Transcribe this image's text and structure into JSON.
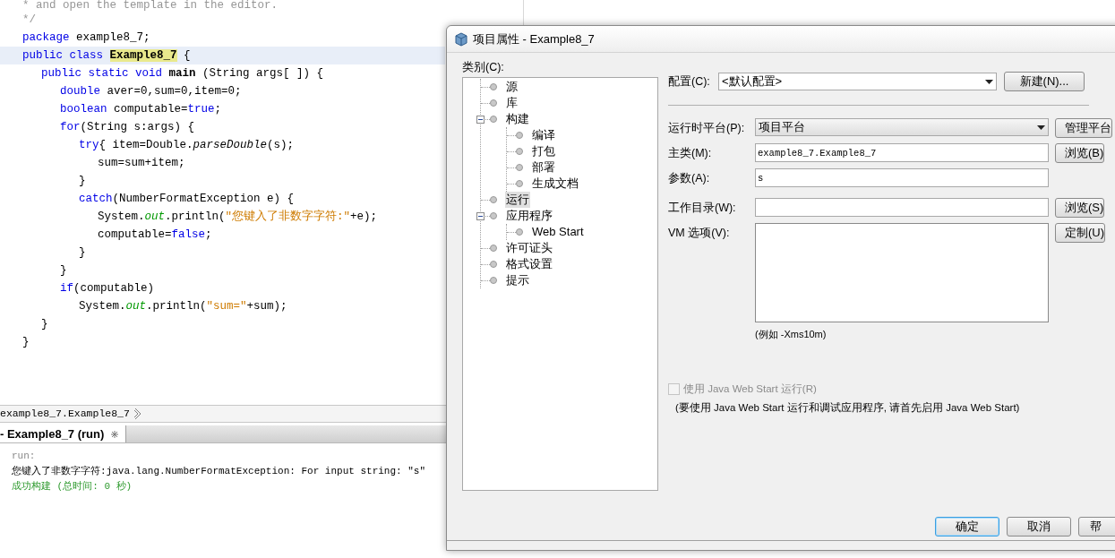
{
  "editor": {
    "lines": [
      {
        "current": false,
        "tokens": [
          {
            "kind": "comment",
            "text": "* and open the template in the editor."
          }
        ]
      },
      {
        "current": false,
        "tokens": [
          {
            "kind": "comment",
            "text": "*/"
          }
        ]
      },
      {
        "current": false,
        "tokens": [
          {
            "kind": "keyword",
            "text": "package"
          },
          {
            "kind": "plain",
            "text": " example8_7;"
          }
        ]
      },
      {
        "current": true,
        "tokens": [
          {
            "kind": "keyword",
            "text": "public class "
          },
          {
            "kind": "mark",
            "text": "Example8_7"
          },
          {
            "kind": "plain",
            "text": " {"
          }
        ],
        "children": [
          {
            "current": false,
            "tokens": [
              {
                "kind": "keyword",
                "text": "public static void "
              },
              {
                "kind": "bold",
                "text": "main"
              },
              {
                "kind": "plain",
                "text": " (String args[ ]) {"
              }
            ],
            "children": [
              {
                "current": false,
                "tokens": [
                  {
                    "kind": "keyword",
                    "text": "double"
                  },
                  {
                    "kind": "plain",
                    "text": " aver=0,sum=0,item=0;"
                  }
                ]
              },
              {
                "current": false,
                "tokens": [
                  {
                    "kind": "keyword",
                    "text": "boolean"
                  },
                  {
                    "kind": "plain",
                    "text": " computable="
                  },
                  {
                    "kind": "keyword",
                    "text": "true"
                  },
                  {
                    "kind": "plain",
                    "text": ";"
                  }
                ]
              },
              {
                "current": false,
                "tokens": [
                  {
                    "kind": "keyword",
                    "text": "for"
                  },
                  {
                    "kind": "plain",
                    "text": "(String s:args) {"
                  }
                ],
                "children": [
                  {
                    "current": false,
                    "tokens": [
                      {
                        "kind": "keyword",
                        "text": "try"
                      },
                      {
                        "kind": "plain",
                        "text": "{ item=Double."
                      },
                      {
                        "kind": "italic",
                        "text": "parseDouble"
                      },
                      {
                        "kind": "plain",
                        "text": "(s);"
                      }
                    ],
                    "children": [
                      {
                        "current": false,
                        "tokens": [
                          {
                            "kind": "plain",
                            "text": "sum=sum+item;"
                          }
                        ]
                      }
                    ]
                  },
                  {
                    "current": false,
                    "tokens": [
                      {
                        "kind": "plain",
                        "text": "}"
                      }
                    ]
                  },
                  {
                    "current": false,
                    "tokens": [
                      {
                        "kind": "keyword",
                        "text": "catch"
                      },
                      {
                        "kind": "plain",
                        "text": "(NumberFormatException e) {"
                      }
                    ],
                    "children": [
                      {
                        "current": false,
                        "tokens": [
                          {
                            "kind": "plain",
                            "text": "System."
                          },
                          {
                            "kind": "field",
                            "text": "out"
                          },
                          {
                            "kind": "plain",
                            "text": ".println("
                          },
                          {
                            "kind": "string",
                            "text": "\"您键入了非数字字符:\""
                          },
                          {
                            "kind": "plain",
                            "text": "+e);"
                          }
                        ]
                      },
                      {
                        "current": false,
                        "tokens": [
                          {
                            "kind": "plain",
                            "text": "computable="
                          },
                          {
                            "kind": "keyword",
                            "text": "false"
                          },
                          {
                            "kind": "plain",
                            "text": ";"
                          }
                        ]
                      }
                    ]
                  },
                  {
                    "current": false,
                    "tokens": [
                      {
                        "kind": "plain",
                        "text": "}"
                      }
                    ]
                  }
                ]
              },
              {
                "current": false,
                "tokens": [
                  {
                    "kind": "plain",
                    "text": "}"
                  }
                ]
              },
              {
                "current": false,
                "tokens": [
                  {
                    "kind": "keyword",
                    "text": "if"
                  },
                  {
                    "kind": "plain",
                    "text": "(computable)"
                  }
                ],
                "children": [
                  {
                    "current": false,
                    "tokens": [
                      {
                        "kind": "plain",
                        "text": "System."
                      },
                      {
                        "kind": "field",
                        "text": "out"
                      },
                      {
                        "kind": "plain",
                        "text": ".println("
                      },
                      {
                        "kind": "string",
                        "text": "\"sum=\""
                      },
                      {
                        "kind": "plain",
                        "text": "+sum);"
                      }
                    ]
                  }
                ]
              }
            ]
          },
          {
            "current": false,
            "tokens": [
              {
                "kind": "plain",
                "text": "}"
              }
            ]
          }
        ]
      },
      {
        "current": false,
        "tokens": [
          {
            "kind": "plain",
            "text": "}"
          }
        ]
      }
    ]
  },
  "breadcrumb": {
    "path": "example8_7.Example8_7"
  },
  "output": {
    "tab": {
      "label": "- Example8_7 (run)",
      "selected": true
    },
    "lines": [
      {
        "kind": "info",
        "text": "run:"
      },
      {
        "kind": "error",
        "text": "您键入了非数字字符:java.lang.NumberFormatException: For input string: \"s\""
      },
      {
        "kind": "success",
        "text": "成功构建 (总时间: 0 秒)"
      }
    ]
  },
  "dialog": {
    "title": "项目属性 - Example8_7",
    "category_label": "类别(C):",
    "tree": [
      {
        "label": "源",
        "selected": false
      },
      {
        "label": "库",
        "selected": false
      },
      {
        "label": "构建",
        "selected": false,
        "expanded": true,
        "children": [
          {
            "label": "编译",
            "selected": false
          },
          {
            "label": "打包",
            "selected": false
          },
          {
            "label": "部署",
            "selected": false
          },
          {
            "label": "生成文档",
            "selected": false
          }
        ]
      },
      {
        "label": "运行",
        "selected": true
      },
      {
        "label": "应用程序",
        "selected": false,
        "expanded": true,
        "children": [
          {
            "label": "Web Start",
            "selected": false
          }
        ]
      },
      {
        "label": "许可证头",
        "selected": false
      },
      {
        "label": "格式设置",
        "selected": false
      },
      {
        "label": "提示",
        "selected": false
      }
    ],
    "config": {
      "label": "配置(C):",
      "value": "<默认配置>",
      "button": "新建(N)..."
    },
    "fields": [
      {
        "kind": "combo",
        "label": "运行时平台(P):",
        "value": "项目平台",
        "button": "管理平台"
      },
      {
        "kind": "text",
        "label": "主类(M):",
        "value": "example8_7.Example8_7",
        "button": "浏览(B)"
      },
      {
        "kind": "text",
        "label": "参数(A):",
        "value": "s"
      },
      {
        "kind": "text",
        "label": "工作目录(W):",
        "button": "浏览(S)"
      },
      {
        "kind": "area",
        "label": "VM 选项(V):",
        "button": "定制(U)",
        "hint": "(例如 -Xms10m)"
      }
    ],
    "web_start": {
      "label": "使用 Java Web Start 运行(R)",
      "checked": false,
      "disabled": true,
      "note": "(要使用 Java Web Start 运行和调试应用程序, 请首先启用 Java Web Start)"
    },
    "buttons": [
      {
        "label": "确定",
        "default": true
      },
      {
        "label": "取消",
        "default": false
      },
      {
        "label": "帮",
        "default": false
      }
    ]
  }
}
